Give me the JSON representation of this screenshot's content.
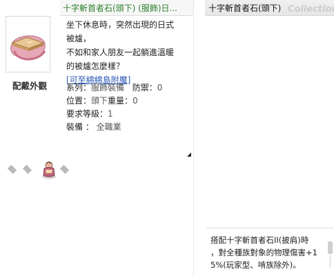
{
  "item_window": {
    "title": "十字斬首者石(頭下) (服飾)日...",
    "wear_label": "配戴外觀",
    "description": [
      "坐下休息時，突然出現的日式",
      "被爐，",
      "不如和家人朋友一起躺進溫暖",
      "的被爐怎麼樣？"
    ],
    "link_text": "[可至綿綿島附魔]",
    "stats": [
      {
        "label": "系列",
        "value": "服飾裝備"
      },
      {
        "label": "防禦",
        "value": "0"
      },
      {
        "label": "位置",
        "value": "頭下"
      },
      {
        "label": "重量",
        "value": "0"
      },
      {
        "label": "要求等級",
        "value": "1"
      },
      {
        "label": "裝備",
        "value": "全職業"
      }
    ]
  },
  "effect_panel": {
    "title": "十字斬首者石(頭下)",
    "watermark": "Collections",
    "effect_lines": [
      "搭配十字斬首者石II(披肩)時",
      "，對全種族對象的物理傷害+1",
      "5%(玩家型、啃族除外)。"
    ]
  }
}
